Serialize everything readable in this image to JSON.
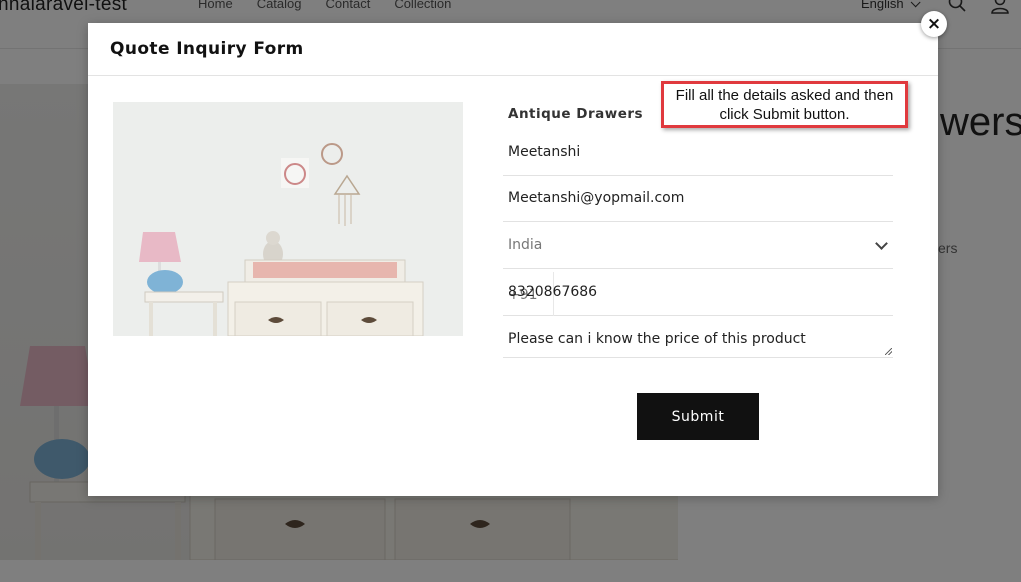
{
  "store": {
    "logo": "nnalaravel-test",
    "nav": [
      "Home",
      "Catalog",
      "Contact",
      "Collection"
    ],
    "language": "English",
    "product_title_partial": "wers",
    "product_sub_partial": "ers"
  },
  "modal": {
    "title": "Quote Inquiry Form",
    "close_glyph": "×",
    "product_name": "Antique Drawers",
    "name_value": "Meetanshi",
    "email_value": "Meetanshi@yopmail.com",
    "country_value": "India",
    "phone_code": "+91",
    "phone_value": "8320867686",
    "message_value": "Please can i know the price of this product",
    "submit_label": "Submit"
  },
  "callout": {
    "text": "Fill all the details asked and then click Submit button."
  },
  "colors": {
    "overlay": "rgba(0,0,0,0.5)",
    "button_bg": "#111111",
    "callout_border": "#e0393e"
  }
}
